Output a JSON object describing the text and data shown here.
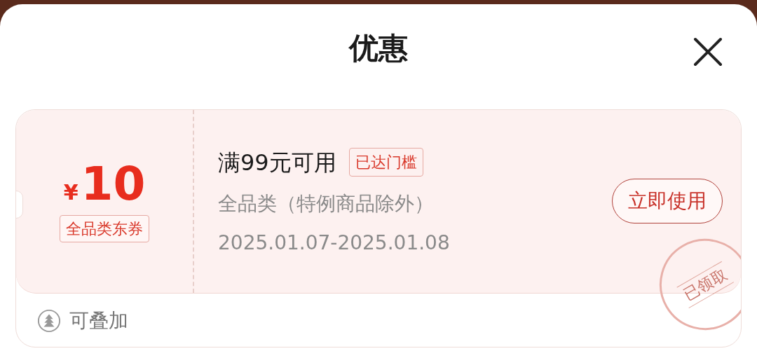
{
  "title": "优惠",
  "coupon": {
    "currency": "¥",
    "amount": "10",
    "type_tag": "全品类东券",
    "condition": "满99元可用",
    "threshold_tag": "已达门槛",
    "scope": "全品类（特例商品除外）",
    "validity": "2025.01.07-2025.01.08",
    "action": "立即使用",
    "stamp": "已领取",
    "stackable": "可叠加"
  }
}
